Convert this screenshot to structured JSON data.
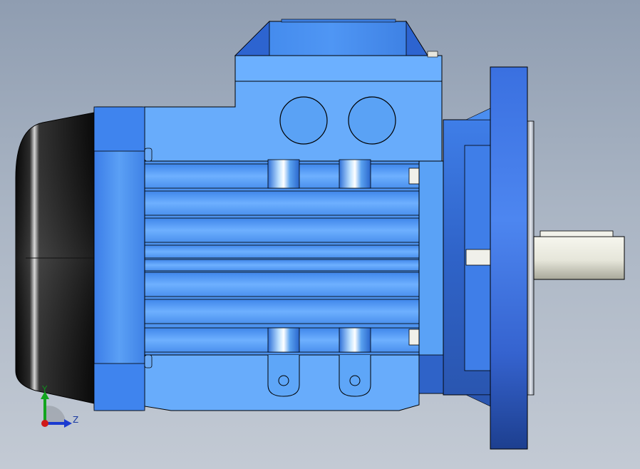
{
  "scene": {
    "subject": "electric-motor-3d-model",
    "colors": {
      "background_top": "#8f9db1",
      "background_bottom": "#c3cad4",
      "motor_body": "#5aa0f0",
      "motor_light": "#8cc4ff",
      "motor_dark": "#2f6fd0",
      "flange": "#2e5cc8",
      "fan_cover": "#111111",
      "shaft": "#e8e8de",
      "outline": "#000000"
    }
  },
  "triad": {
    "y_label": "Y",
    "z_label": "Z",
    "y_color": "#12a51e",
    "z_color": "#1a3ad0",
    "x_color": "#d01818"
  }
}
